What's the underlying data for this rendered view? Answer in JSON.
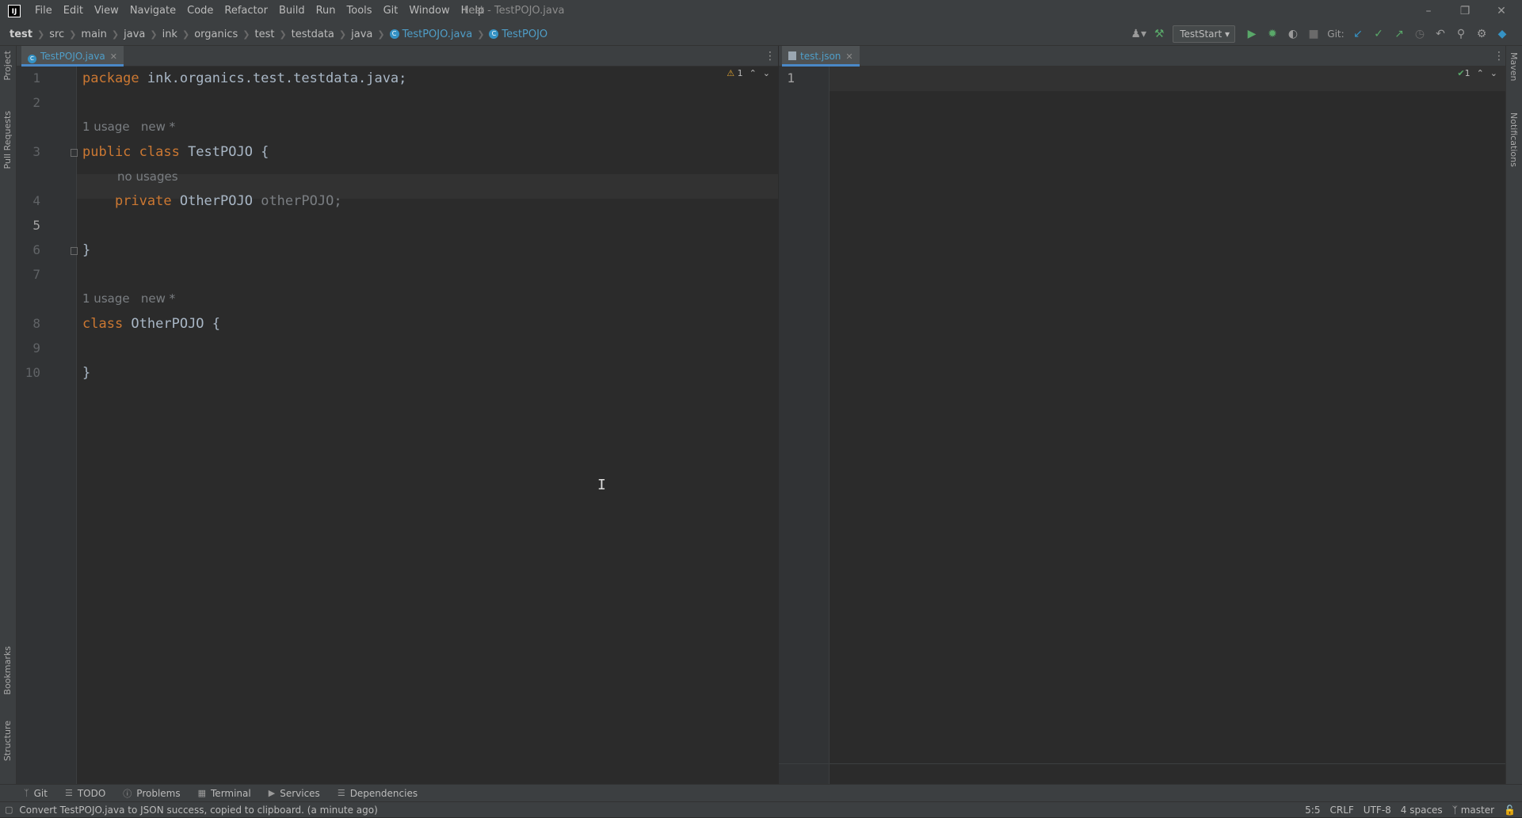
{
  "menubar": {
    "logo": "IJ",
    "menus": [
      "File",
      "Edit",
      "View",
      "Navigate",
      "Code",
      "Refactor",
      "Build",
      "Run",
      "Tools",
      "Git",
      "Window",
      "Help"
    ],
    "title": "test - TestPOJO.java"
  },
  "breadcrumbs": [
    "test",
    "src",
    "main",
    "java",
    "ink",
    "organics",
    "test",
    "testdata",
    "java",
    "TestPOJO.java",
    "TestPOJO"
  ],
  "toolbar": {
    "run_config": "TestStart",
    "git_label": "Git:"
  },
  "left_tools": [
    "Project",
    "Pull Requests",
    "Bookmarks",
    "Structure"
  ],
  "right_tools": [
    "Maven",
    "Notifications"
  ],
  "left_editor": {
    "tab": "TestPOJO.java",
    "warnings": "1",
    "lines": [
      "1",
      "2",
      "3",
      "4",
      "5",
      "6",
      "7",
      "8",
      "9",
      "10"
    ],
    "hint_usage_1": "1 usage   new *",
    "hint_no_usages": "no usages",
    "hint_usage_2": "1 usage   new *",
    "code": {
      "l1_kw": "package",
      "l1_rest": " ink.organics.test.testdata.java;",
      "l3_kw": "public class",
      "l3_rest": " TestPOJO {",
      "l4_kw": "private",
      "l4_type": " OtherPOJO ",
      "l4_field": "otherPOJO;",
      "l6": "}",
      "l8_kw": "class",
      "l8_rest": " OtherPOJO {",
      "l10": "}"
    }
  },
  "right_editor": {
    "tab": "test.json",
    "ok_count": "1",
    "lines": [
      "1"
    ]
  },
  "tool_windows": [
    "Git",
    "TODO",
    "Problems",
    "Terminal",
    "Services",
    "Dependencies"
  ],
  "status": {
    "message": "Convert TestPOJO.java to JSON success, copied to clipboard. (a minute ago)",
    "position": "5:5",
    "line_sep": "CRLF",
    "encoding": "UTF-8",
    "indent": "4 spaces",
    "branch": "master"
  }
}
